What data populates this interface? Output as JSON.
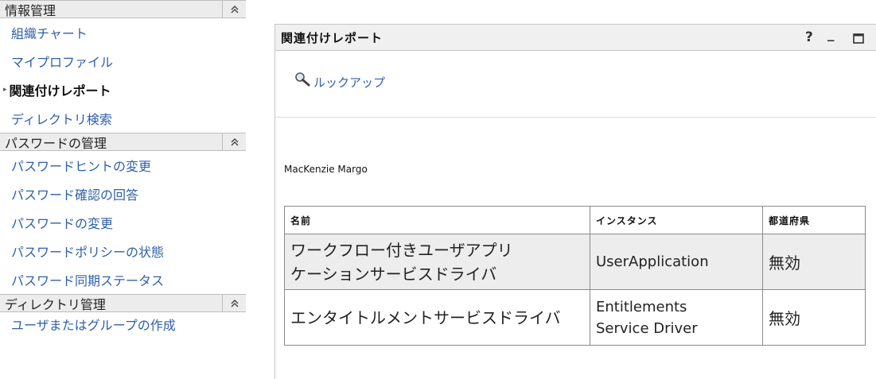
{
  "sidebar": {
    "sections": [
      {
        "title": "情報管理",
        "items": [
          {
            "label": "組織チャート",
            "active": false
          },
          {
            "label": "マイプロファイル",
            "active": false
          },
          {
            "label": "関連付けレポート",
            "active": true
          },
          {
            "label": "ディレクトリ検索",
            "active": false
          }
        ]
      },
      {
        "title": "パスワードの管理",
        "items": [
          {
            "label": "パスワードヒントの変更",
            "active": false
          },
          {
            "label": "パスワード確認の回答",
            "active": false
          },
          {
            "label": "パスワードの変更",
            "active": false
          },
          {
            "label": "パスワードポリシーの状態",
            "active": false
          },
          {
            "label": "パスワード同期ステータス",
            "active": false
          }
        ]
      },
      {
        "title": "ディレクトリ管理",
        "items": [
          {
            "label": "ユーザまたはグループの作成",
            "active": false
          }
        ]
      }
    ],
    "collapse_icon": "double-chevron-up-icon"
  },
  "portlet": {
    "title": "関連付けレポート",
    "help_label": "?",
    "minimize_label": "_",
    "maximize_icon": "maximize-icon",
    "lookup_icon": "magnifier-icon",
    "lookup_label": "ルックアップ",
    "user_name": "MacKenzie Margo",
    "table": {
      "headers": [
        "名前",
        "インスタンス",
        "都道府県"
      ],
      "rows": [
        {
          "name": "ワークフロー付きユーザアプリケーションサービスドライバ",
          "name_lines": [
            "ワークフロー付きユーザアプリ",
            "ケーションサービスドライバ"
          ],
          "instance": "UserApplication",
          "instance_lines": [
            "UserApplication"
          ],
          "status": "無効"
        },
        {
          "name": "エンタイトルメントサービスドライバ",
          "name_lines": [
            "エンタイトルメントサービスドライバ"
          ],
          "instance": "Entitlements Service Driver",
          "instance_lines": [
            "Entitlements",
            "Service Driver"
          ],
          "status": "無効"
        }
      ]
    }
  }
}
